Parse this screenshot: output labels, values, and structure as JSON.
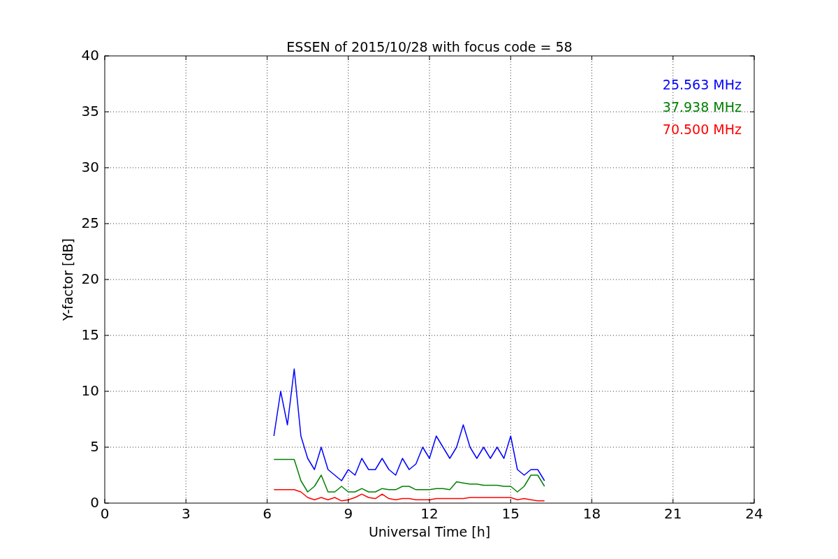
{
  "figure": {
    "chart_data": {
      "type": "line",
      "title": "ESSEN of 2015/10/28 with focus code = 58",
      "xlabel": "Universal Time [h]",
      "ylabel": "Y-factor [dB]",
      "x": [
        6.25,
        6.5,
        6.75,
        7.0,
        7.25,
        7.5,
        7.75,
        8.0,
        8.25,
        8.5,
        8.75,
        9.0,
        9.25,
        9.5,
        9.75,
        10.0,
        10.25,
        10.5,
        10.75,
        11.0,
        11.25,
        11.5,
        11.75,
        12.0,
        12.25,
        12.5,
        12.75,
        13.0,
        13.25,
        13.5,
        13.75,
        14.0,
        14.25,
        14.5,
        14.75,
        15.0,
        15.25,
        15.5,
        15.75,
        16.0,
        16.25
      ],
      "series": [
        {
          "name": "25.563 MHz",
          "color": "#0000ff",
          "values": [
            6,
            10,
            7,
            12,
            6,
            4,
            3,
            5,
            3,
            2.5,
            2,
            3,
            2.5,
            4,
            3,
            3,
            4,
            3,
            2.5,
            4,
            3,
            3.5,
            5,
            4,
            6,
            5,
            4,
            5,
            7,
            5,
            4,
            5,
            4,
            5,
            4,
            6,
            3,
            2.5,
            3,
            3,
            2
          ]
        },
        {
          "name": "37.938 MHz",
          "color": "#008000",
          "values": [
            3.9,
            3.9,
            3.9,
            3.9,
            2,
            1,
            1.5,
            2.5,
            1,
            1,
            1.5,
            1,
            1,
            1.3,
            1,
            1,
            1.3,
            1.2,
            1.2,
            1.5,
            1.5,
            1.2,
            1.2,
            1.2,
            1.3,
            1.3,
            1.2,
            1.9,
            1.8,
            1.7,
            1.7,
            1.6,
            1.6,
            1.6,
            1.5,
            1.5,
            1,
            1.5,
            2.5,
            2.5,
            1.5
          ]
        },
        {
          "name": "70.500 MHz",
          "color": "#ff0000",
          "values": [
            1.2,
            1.2,
            1.2,
            1.2,
            1,
            0.5,
            0.3,
            0.5,
            0.3,
            0.5,
            0.2,
            0.3,
            0.5,
            0.8,
            0.5,
            0.4,
            0.8,
            0.4,
            0.3,
            0.4,
            0.4,
            0.3,
            0.3,
            0.3,
            0.4,
            0.4,
            0.4,
            0.4,
            0.4,
            0.5,
            0.5,
            0.5,
            0.5,
            0.5,
            0.5,
            0.5,
            0.3,
            0.4,
            0.3,
            0.2,
            0.2
          ]
        }
      ],
      "grid": true,
      "xlim": [
        0,
        24
      ],
      "ylim": [
        0,
        40
      ],
      "xticks": [
        0,
        3,
        6,
        9,
        12,
        15,
        18,
        21,
        24
      ],
      "yticks": [
        0,
        5,
        10,
        15,
        20,
        25,
        30,
        35,
        40
      ]
    }
  }
}
